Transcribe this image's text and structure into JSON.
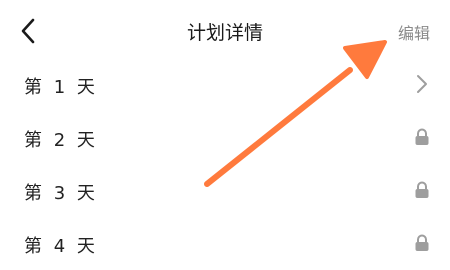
{
  "header": {
    "back_icon": "chevron-left-icon",
    "title": "计划详情",
    "edit_label": "编辑"
  },
  "days": [
    {
      "label": "第 1 天",
      "status_icon": "chevron-right-icon",
      "locked": false
    },
    {
      "label": "第 2 天",
      "status_icon": "lock-icon",
      "locked": true
    },
    {
      "label": "第 3 天",
      "status_icon": "lock-icon",
      "locked": true
    },
    {
      "label": "第 4 天",
      "status_icon": "lock-icon",
      "locked": true
    }
  ],
  "colors": {
    "arrow": "#FF7A3D",
    "icon_gray": "#9E9E9E",
    "text": "#222222",
    "edit_text": "#8A8A8A"
  },
  "annotation": {
    "type": "arrow",
    "points_to": "edit-button"
  }
}
